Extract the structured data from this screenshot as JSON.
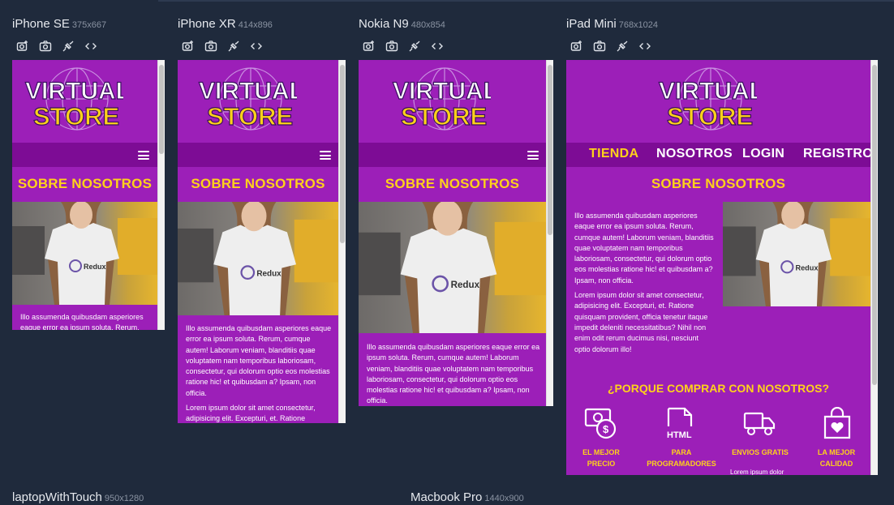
{
  "devices": [
    {
      "name": "iPhone SE",
      "dims": "375x667"
    },
    {
      "name": "iPhone XR",
      "dims": "414x896"
    },
    {
      "name": "Nokia N9",
      "dims": "480x854"
    },
    {
      "name": "iPad Mini",
      "dims": "768x1024"
    },
    {
      "name": "laptopWithTouch",
      "dims": "950x1280"
    },
    {
      "name": "Macbook Pro",
      "dims": "1440x900"
    }
  ],
  "site": {
    "logo_line1": "VIRTUAL",
    "logo_line2": "STORE",
    "section_title": "SOBRE NOSOTROS",
    "shirt_brand": "Redux",
    "nav": [
      "TIENDA",
      "NOSOTROS",
      "LOGIN",
      "REGISTRO"
    ],
    "paragraph1": "Illo assumenda quibusdam asperiores eaque error ea ipsum soluta. Rerum, cumque autem! Laborum veniam, blanditiis quae voluptatem nam temporibus laboriosam, consectetur, qui dolorum optio eos molestias ratione hic! et quibusdam a? Ipsam, non officia.",
    "paragraph2": "Lorem ipsum dolor sit amet consectetur, adipisicing elit. Excepturi, et. Ratione quisquam provident, officia tenetur itaque impedit deleniti necessitatibus? Nihil non enim odit rerum ducimus nisi, nesciunt optio dolorum illo!",
    "p2_short_se": "Lorem ipsum dolor sit amet consectetur, adipisicing elit. Excepturi, et. Ratione",
    "why_title": "¿PORQUE COMPRAR CON NOSOTROS?",
    "features": [
      {
        "line1": "EL MEJOR",
        "line2": "PRECIO",
        "icon": "money-icon"
      },
      {
        "line1": "PARA",
        "line2": "PROGRAMADORES",
        "icon": "html-file-icon"
      },
      {
        "line1": "ENVIOS GRATIS",
        "line2": "",
        "icon": "truck-icon"
      },
      {
        "line1": "LA MEJOR",
        "line2": "CALIDAD",
        "icon": "heart-bag-icon"
      }
    ],
    "feature_text": "Lorem ipsum dolor",
    "html_label": "HTML",
    "money_symbol": "$"
  },
  "colors": {
    "background": "#1f2a3c",
    "brand_purple": "#9c1fb8",
    "nav_purple": "#7d0c95",
    "accent_yellow": "#ffd21a"
  }
}
